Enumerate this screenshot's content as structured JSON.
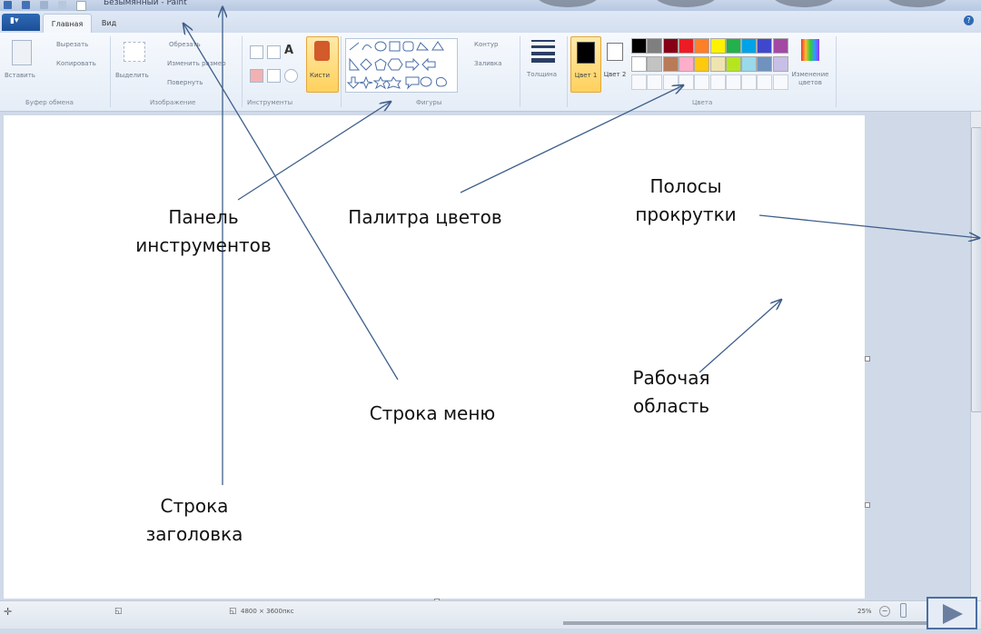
{
  "titlebar": {
    "title": "Безымянный - Paint"
  },
  "tabs": {
    "home": "Главная",
    "view": "Вид"
  },
  "ribbon": {
    "clipboard": {
      "paste": "Вставить",
      "cut": "Вырезать",
      "copy": "Копировать",
      "group": "Буфер обмена"
    },
    "image": {
      "select": "Выделить",
      "crop": "Обрезать",
      "resize": "Изменить размер",
      "rotate": "Повернуть",
      "group": "Изображение"
    },
    "tools": {
      "group": "Инструменты",
      "brushes": "Кисти"
    },
    "shapes": {
      "outline": "Контур",
      "fill": "Заливка",
      "group": "Фигуры"
    },
    "size": {
      "label": "Толщина"
    },
    "colors": {
      "color1": "Цвет 1",
      "color2": "Цвет 2",
      "edit": "Изменение цветов",
      "group": "Цвета",
      "row1": [
        "#000000",
        "#7f7f7f",
        "#880015",
        "#ed1c24",
        "#ff7f27",
        "#fff200",
        "#22b14c",
        "#00a2e8",
        "#3f48cc",
        "#a349a4"
      ],
      "row2": [
        "#ffffff",
        "#c3c3c3",
        "#b97a57",
        "#ffaec9",
        "#ffc90e",
        "#efe4b0",
        "#b5e61d",
        "#99d9ea",
        "#7092be",
        "#c8bfe7"
      ]
    }
  },
  "status": {
    "dimensions": "4800 × 3600пкс",
    "zoom": "25%"
  },
  "annotations": {
    "toolbar_line1": "Панель",
    "toolbar_line2": "инструментов",
    "palette": "Палитра цветов",
    "scrollbars_line1": "Полосы",
    "scrollbars_line2": "прокрутки",
    "workarea_line1": "Рабочая",
    "workarea_line2": "область",
    "menu_bar": "Строка меню",
    "titlebar_line1": "Строка",
    "titlebar_line2": "заголовка"
  }
}
